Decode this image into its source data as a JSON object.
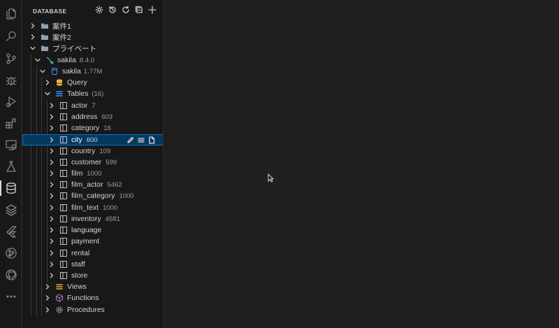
{
  "sidebar": {
    "title": "DATABASE",
    "actions": [
      "gear-icon",
      "history-icon",
      "refresh-icon",
      "collapse-all-icon",
      "add-icon"
    ]
  },
  "activity": [
    "explorer-icon",
    "search-icon",
    "source-control-icon",
    "debug-icon",
    "run-debug-icon",
    "extensions-icon",
    "remote-explorer-icon",
    "testing-icon",
    "database-icon",
    "layers-icon",
    "flutter-icon",
    "git-graph-icon",
    "github-icon",
    "more-icon"
  ],
  "tree": {
    "folders": [
      {
        "label": "案件1"
      },
      {
        "label": "案件2"
      },
      {
        "label": "プライベート"
      }
    ],
    "connection": {
      "label": "sakila",
      "version": "8.4.0"
    },
    "database": {
      "label": "sakila",
      "size": "1.77M"
    },
    "query": {
      "label": "Query"
    },
    "tables": {
      "label": "Tables",
      "count": "(16)"
    },
    "table_items": [
      {
        "label": "actor",
        "count": "7"
      },
      {
        "label": "address",
        "count": "603"
      },
      {
        "label": "category",
        "count": "16"
      },
      {
        "label": "city",
        "count": "600"
      },
      {
        "label": "country",
        "count": "109"
      },
      {
        "label": "customer",
        "count": "599"
      },
      {
        "label": "film",
        "count": "1000"
      },
      {
        "label": "film_actor",
        "count": "5462"
      },
      {
        "label": "film_category",
        "count": "1000"
      },
      {
        "label": "film_text",
        "count": "1000"
      },
      {
        "label": "inventory",
        "count": "4581"
      },
      {
        "label": "language",
        "count": ""
      },
      {
        "label": "payment",
        "count": ""
      },
      {
        "label": "rental",
        "count": ""
      },
      {
        "label": "staff",
        "count": ""
      },
      {
        "label": "store",
        "count": ""
      }
    ],
    "views": {
      "label": "Views"
    },
    "functions": {
      "label": "Functions"
    },
    "procedures": {
      "label": "Procedures"
    }
  },
  "colors": {
    "accent": "#0078d4",
    "selected_bg": "#04395e",
    "folder": "#8fa1b3",
    "table_icon": "#c5c5c5",
    "query_icon": "#e8b339",
    "tables_icon": "#3794ff",
    "views_icon": "#e8b339",
    "functions_icon": "#b180d7",
    "db_icon": "#3794ff",
    "status_dot": "#3fb950"
  }
}
